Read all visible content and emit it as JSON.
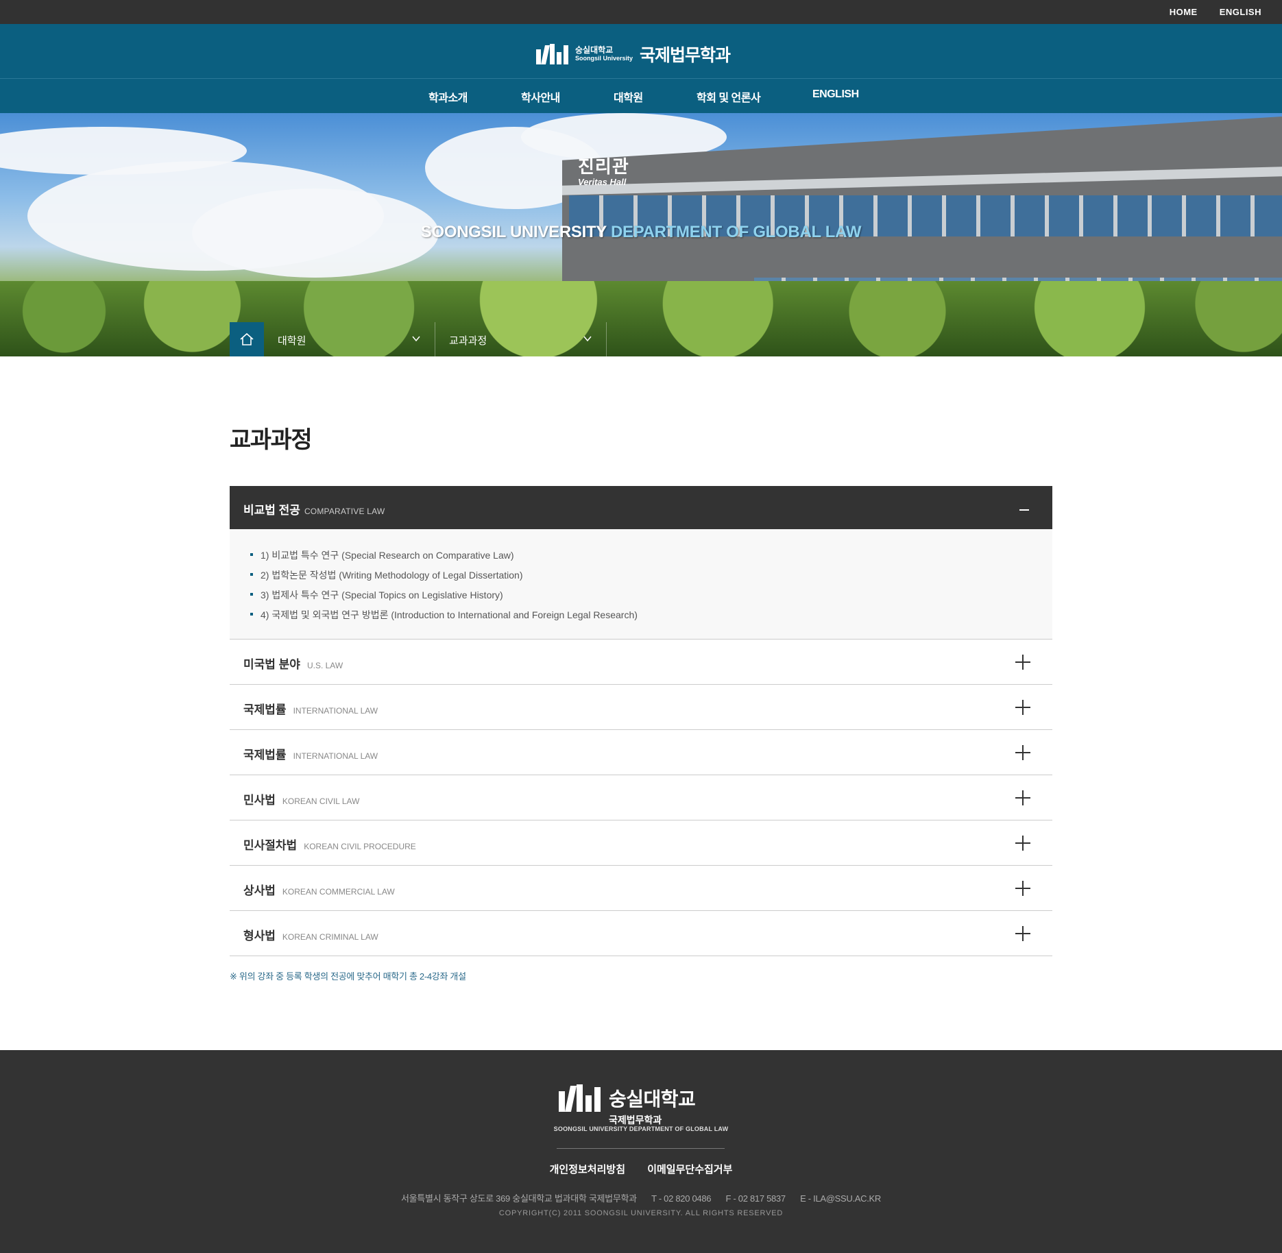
{
  "topbar": {
    "home": "HOME",
    "english": "ENGLISH"
  },
  "header": {
    "logo_ko": "숭실대학교",
    "logo_en": "Soongsil University",
    "dept": "국제법무학과"
  },
  "nav": {
    "items": [
      {
        "label": "학과소개"
      },
      {
        "label": "학사안내"
      },
      {
        "label": "대학원"
      },
      {
        "label": "학회 및 언론사"
      },
      {
        "label": "ENGLISH"
      }
    ]
  },
  "hero": {
    "sign_ko": "진리관",
    "sign_en": "Veritas Hall",
    "slogan_white": "SOONGSIL UNIVERSITY",
    "slogan_blue": "DEPARTMENT OF GLOBAL LAW"
  },
  "breadcrumb": {
    "level1": "대학원",
    "level2": "교과과정"
  },
  "main": {
    "title": "교과과정",
    "open_section": {
      "title": "비교법 전공",
      "subtitle": "COMPARATIVE LAW",
      "items": [
        "1) 비교법 특수 연구 (Special Research on Comparative Law)",
        "2) 법학논문 작성법 (Writing Methodology of Legal Dissertation)",
        "3) 법제사 특수 연구 (Special Topics on Legislative History)",
        "4) 국제법 및 외국법 연구 방법론 (Introduction to International and Foreign Legal Research)"
      ]
    },
    "sections": [
      {
        "title": "미국법 분야",
        "subtitle": "U.S. LAW"
      },
      {
        "title": "국제법률",
        "subtitle": "INTERNATIONAL LAW"
      },
      {
        "title": "국제법률",
        "subtitle": "INTERNATIONAL LAW"
      },
      {
        "title": "민사법",
        "subtitle": "KOREAN CIVIL LAW"
      },
      {
        "title": "민사절차법",
        "subtitle": "KOREAN CIVIL PROCEDURE"
      },
      {
        "title": "상사법",
        "subtitle": "KOREAN COMMERCIAL LAW"
      },
      {
        "title": "형사법",
        "subtitle": "KOREAN CRIMINAL LAW"
      }
    ],
    "note": "※ 위의 강좌 중 등록 학생의 전공에 맞추어 매학기 총 2-4강좌 개설"
  },
  "footer": {
    "logo_ko": "숭실대학교",
    "logo_dept": "국제법무학과",
    "logo_en": "SOONGSIL UNIVERSITY DEPARTMENT OF GLOBAL LAW",
    "privacy": "개인정보처리방침",
    "email_refuse": "이메일무단수집거부",
    "address": "서울특별시 동작구 상도로 369 숭실대학교 법과대학 국제법무학과",
    "tel": "T - 02 820 0486",
    "fax": "F - 02 817 5837",
    "email": "E - ILA@SSU.AC.KR",
    "copyright": "COPYRIGHT(C) 2011 SOONGSIL UNIVERSITY. ALL RIGHTS RESERVED"
  },
  "colors": {
    "brand": "#0b5f80",
    "dark": "#333333",
    "topbar": "#323232"
  }
}
